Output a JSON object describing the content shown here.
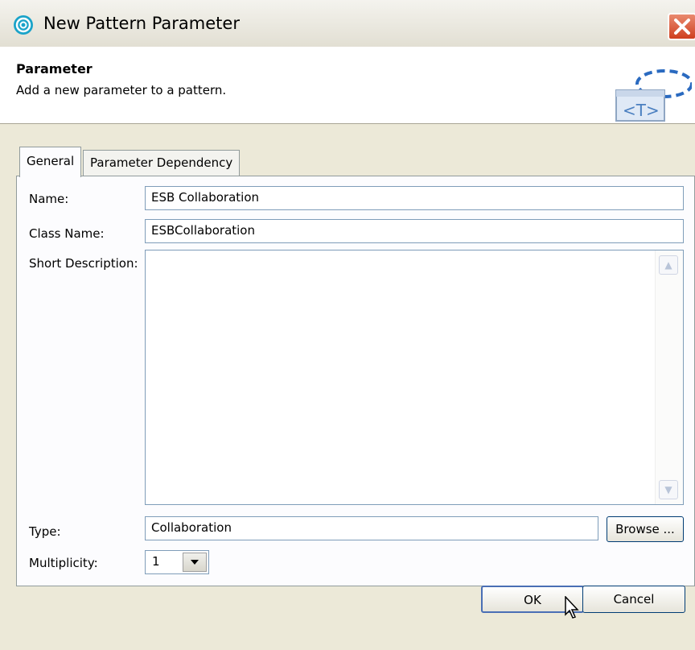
{
  "window": {
    "title": "New Pattern Parameter"
  },
  "header": {
    "title": "Parameter",
    "description": "Add a new parameter to a pattern."
  },
  "tabs": [
    {
      "label": "General",
      "active": true
    },
    {
      "label": "Parameter Dependency",
      "active": false
    }
  ],
  "form": {
    "name_label": "Name:",
    "name_value": "ESB Collaboration",
    "class_name_label": "Class Name:",
    "class_name_value": "ESBCollaboration",
    "short_description_label": "Short Description:",
    "short_description_value": "",
    "type_label": "Type:",
    "type_value": "Collaboration",
    "browse_label": "Browse ...",
    "multiplicity_label": "Multiplicity:",
    "multiplicity_value": "1"
  },
  "buttons": {
    "ok": "OK",
    "cancel": "Cancel"
  },
  "icons": {
    "app": "app-swirl-icon",
    "close": "close-icon",
    "banner": "template-parameter-icon",
    "dropdown": "chevron-down-icon",
    "scroll_up": "scroll-up-icon",
    "scroll_down": "scroll-down-icon",
    "cursor": "mouse-pointer-icon"
  },
  "colors": {
    "close_button": "#cf3f1f",
    "dialog_bg": "#ece9d8",
    "field_border": "#7f9db9"
  }
}
